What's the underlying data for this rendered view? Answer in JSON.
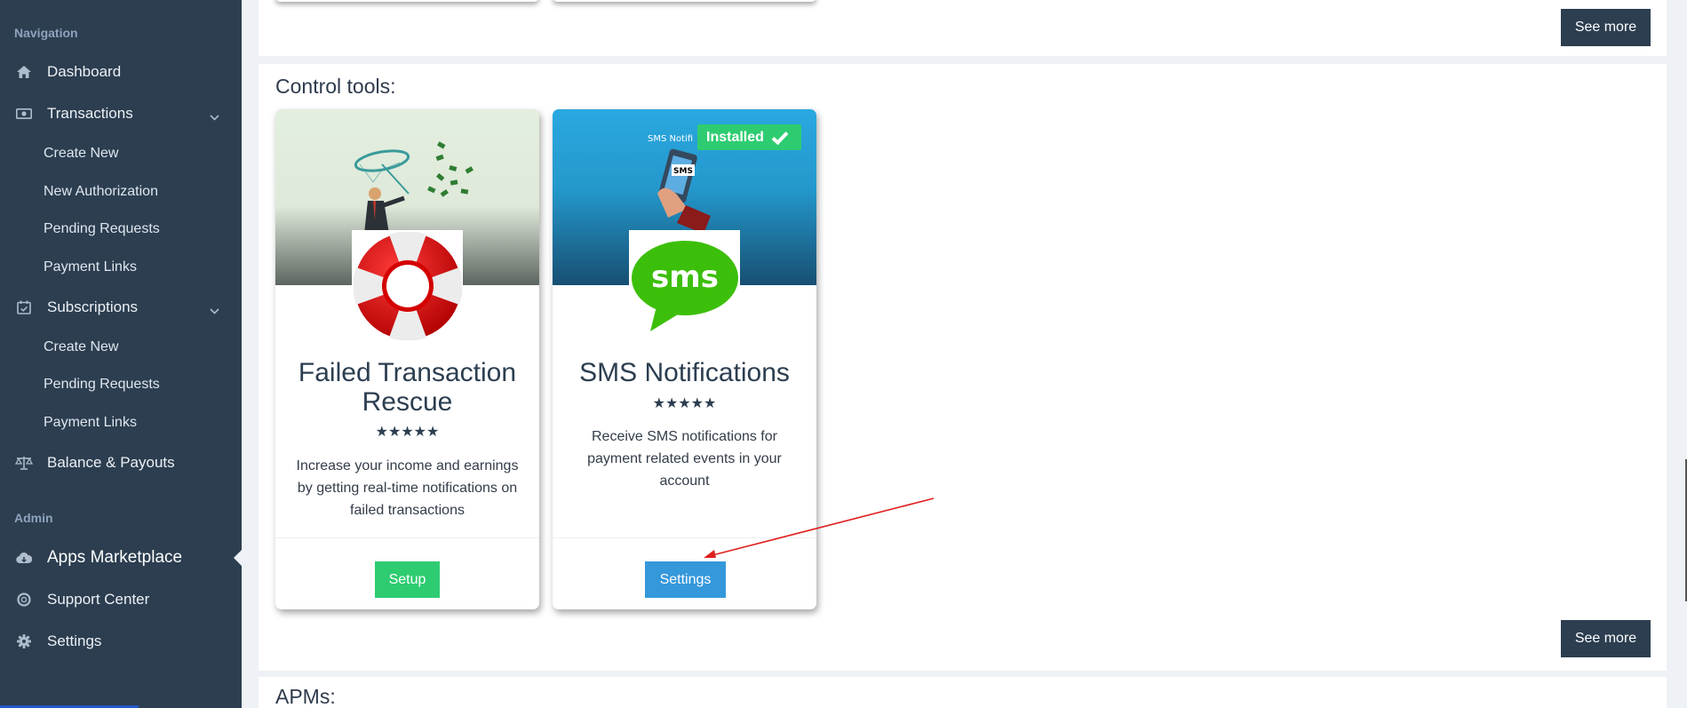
{
  "sidebar": {
    "sections": {
      "navigation": "Navigation",
      "admin": "Admin"
    },
    "items": {
      "dashboard": "Dashboard",
      "transactions": "Transactions",
      "tx_create": "Create New",
      "tx_new_auth": "New Authorization",
      "tx_pending": "Pending Requests",
      "tx_links": "Payment Links",
      "subscriptions": "Subscriptions",
      "sub_create": "Create New",
      "sub_pending": "Pending Requests",
      "sub_links": "Payment Links",
      "balance": "Balance & Payouts",
      "apps": "Apps Marketplace",
      "support": "Support Center",
      "settings": "Settings"
    }
  },
  "main": {
    "see_more_label": "See more",
    "control_tools_title": "Control tools:",
    "apms_title": "APMs:",
    "cards": [
      {
        "title": "Failed Transaction Rescue",
        "stars": "★★★★★",
        "description": "Increase your income and earnings by getting real-time notifications on failed transactions",
        "button": "Setup",
        "button_color": "#2ecc71"
      },
      {
        "title": "SMS Notifications",
        "stars": "★★★★★",
        "description": "Receive SMS notifications for payment related events in your account",
        "button": "Settings",
        "button_color": "#3498db",
        "badge": "Installed",
        "banner_text": "SMS Notifi",
        "logo_text": "sms",
        "phone_text": "SMS"
      }
    ]
  },
  "colors": {
    "sidebar": "#2c3e50",
    "accent_green": "#2ecc71",
    "accent_blue": "#3498db",
    "arrow": "#e02020"
  }
}
